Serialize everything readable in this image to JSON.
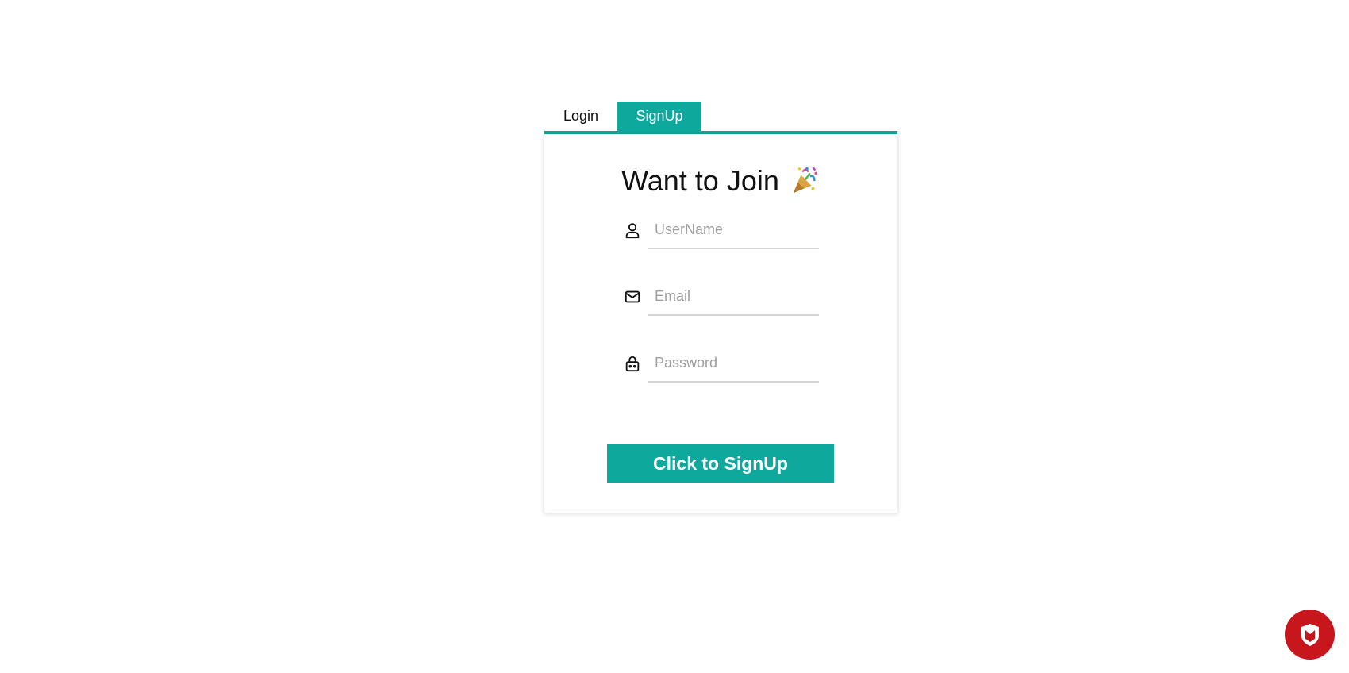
{
  "tabs": [
    {
      "label": "Login",
      "active": false
    },
    {
      "label": "SignUp",
      "active": true
    }
  ],
  "form": {
    "heading": "Want to Join",
    "heading_icon": "party-popper-icon",
    "fields": {
      "username": {
        "placeholder": "UserName",
        "icon": "user-icon"
      },
      "email": {
        "placeholder": "Email",
        "icon": "mail-icon"
      },
      "password": {
        "placeholder": "Password",
        "icon": "lock-icon"
      }
    },
    "submit_label": "Click to SignUp"
  },
  "colors": {
    "accent": "#0ea89c",
    "badge": "#c8161d"
  },
  "badge": {
    "icon": "shield-logo-icon"
  }
}
